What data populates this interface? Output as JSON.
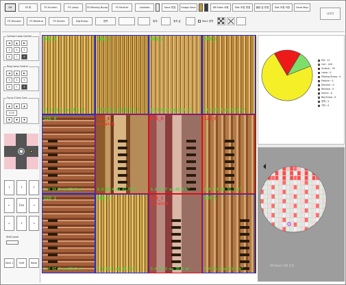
{
  "toolbar": {
    "row1": [
      "DB",
      "FS 파",
      "FS Scratch",
      "FS Lamp",
      "FS Missing Bump",
      "FS Particle",
      "Lossless",
      "Save 변경",
      "Image Save"
    ],
    "row1b": [
      "DB Data 삭제",
      "Slot 조정 변경",
      "불량 분 변경",
      "Slot 조정 저장",
      "Save Map"
    ],
    "row2": [
      "FS Discolor",
      "FS Residue",
      "FS Shorts",
      "Big Bump",
      "영역",
      "",
      ""
    ],
    "row2_labels": [
      "위치:",
      "위치 값"
    ],
    "row2_toggle": "Mark 영역",
    "exit": "나가기"
  },
  "left": {
    "group1": "Contact Lamp Control",
    "group2": "Ring Lamp Control",
    "group3": "Focus Z Axis Cont.",
    "num_grid": [
      "0",
      "1",
      "2",
      "3",
      "4",
      "5",
      "6",
      "7",
      "8"
    ],
    "focus_val": "0.05",
    "arrows": [
      "↑",
      "←",
      "Cen",
      "→",
      "↓",
      "↙",
      "↘"
    ],
    "bottom": [
      "Save 1",
      "Shift",
      "Reset"
    ],
    "label_tinput": "Shift Level"
  },
  "grid": {
    "cells": [
      {
        "name": "080_0",
        "stat": "",
        "meas": "51.3 81.5 ea 30.0 m²"
      },
      {
        "name": "080_1",
        "stat": "",
        "meas": "63.9 85.4 ea 38.0 m²"
      },
      {
        "name": "080_2",
        "stat": "",
        "meas": "61.9 86.4 ea 38.1 m²"
      },
      {
        "name": "080_3",
        "stat": "",
        "meas": "51.2 85.4 ea 38.0 m²"
      },
      {
        "name": "125_0",
        "stat": "",
        "meas": "5.4 39.9 ea 32.9 m²"
      },
      {
        "name": "130_0",
        "stat": "Scratch",
        "meas": "5.4 38.4 ea 43.7 m²"
      },
      {
        "name": "135_0",
        "stat": "",
        "meas": "5.4 31.7 ea 43.1 m²"
      },
      {
        "name": "120_0",
        "stat": "",
        "meas": "5.4 7.8 ea 38.7 m²"
      },
      {
        "name": "125_1",
        "stat": "",
        "meas": "5.4 42.3 ea 28.5 m²"
      },
      {
        "name": "080_4",
        "stat": "",
        "meas": "5.8 36.1 ea 29.3 m²"
      },
      {
        "name": "130_1",
        "stat": "Scratch",
        "meas": "5.4 37.2 ea 39.2 m²"
      },
      {
        "name": "135_1",
        "stat": "",
        "meas": "5.4 36.3 ea 33.2 m²"
      }
    ]
  },
  "pie": {
    "legend": [
      {
        "label": "Pat : 21",
        "color": "#7ede6a"
      },
      {
        "label": "Cell : 148",
        "color": "#f4ef27"
      },
      {
        "label": "Scratch : 35",
        "color": "#ee1a1a"
      },
      {
        "label": "Lamp : 0",
        "color": "#2d45d6"
      },
      {
        "label": "Missing Bump : 0",
        "color": "#ff8c00"
      },
      {
        "label": "Particle : 0",
        "color": "#9a2be2"
      },
      {
        "label": "Discolor : 0",
        "color": "#00a5c8"
      },
      {
        "label": "Residue : 0",
        "color": "#7a3b10"
      },
      {
        "label": "Shorts : 0",
        "color": "#5a5a5a"
      },
      {
        "label": "Big Bump : 0",
        "color": "#ffd38c"
      },
      {
        "label": "영역 : 0",
        "color": "#8fcf8f"
      },
      {
        "label": "기타 : 0",
        "color": "#f39ab9"
      }
    ]
  },
  "chart_data": {
    "type": "pie",
    "categories": [
      "Pat",
      "Cell",
      "Scratch"
    ],
    "values": [
      21,
      148,
      35
    ],
    "title": ""
  },
  "wafer": {
    "watermark": "Windows 정품 인증"
  }
}
